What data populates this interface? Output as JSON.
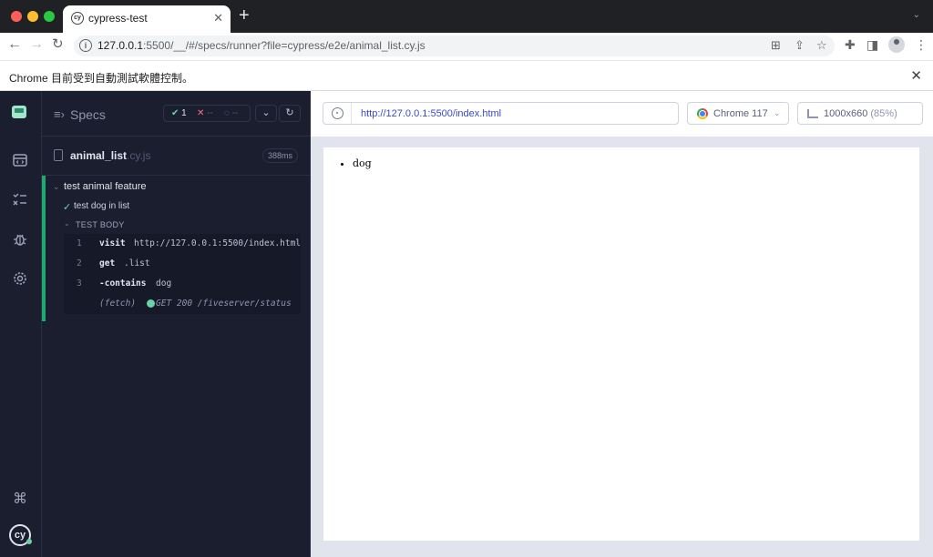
{
  "browser": {
    "tab_title": "cypress-test",
    "tab_favicon": "cy",
    "new_tab_label": "+",
    "address": {
      "host": "127.0.0.1",
      "rest": ":5500/__/#/specs/runner?file=cypress/e2e/animal_list.cy.js"
    },
    "infobar_text": "Chrome 目前受到自動測試軟體控制。",
    "icons": [
      "back-icon",
      "forward-icon",
      "reload-icon",
      "info-icon",
      "translate-icon",
      "share-icon",
      "bookmark-star-icon",
      "extensions-icon",
      "side-panel-icon",
      "profile-icon",
      "menu-icon"
    ]
  },
  "nav_rail": {
    "items": [
      "specs-icon",
      "runs-icon",
      "debug-icon",
      "settings-icon"
    ],
    "shortcut_icon_glyph": "⌘",
    "badge_text": "cy"
  },
  "reporter": {
    "header_title": "Specs",
    "stats": {
      "passed": "1",
      "failed": "--",
      "pending": "--"
    },
    "spec_file": {
      "name": "animal_list",
      "ext": ".cy.js",
      "duration": "388ms"
    },
    "suite_title": "test animal feature",
    "test_title": "test dog in list",
    "body_title": "TEST BODY",
    "commands": [
      {
        "num": "1",
        "name": "visit",
        "msg": "http://127.0.0.1:5500/index.html"
      },
      {
        "num": "2",
        "name": "get",
        "msg": ".list"
      },
      {
        "num": "3",
        "name": "-contains",
        "msg": "dog"
      }
    ],
    "fetch": {
      "name": "(fetch)",
      "msg": "GET 200 /fiveserver/status",
      "status_color": "#69d3a7"
    }
  },
  "runner": {
    "url": "http://127.0.0.1:5500/index.html",
    "browser": "Chrome 117",
    "viewport": "1000x660",
    "zoom": "(85%)"
  },
  "aut": {
    "items": [
      "dog"
    ]
  }
}
